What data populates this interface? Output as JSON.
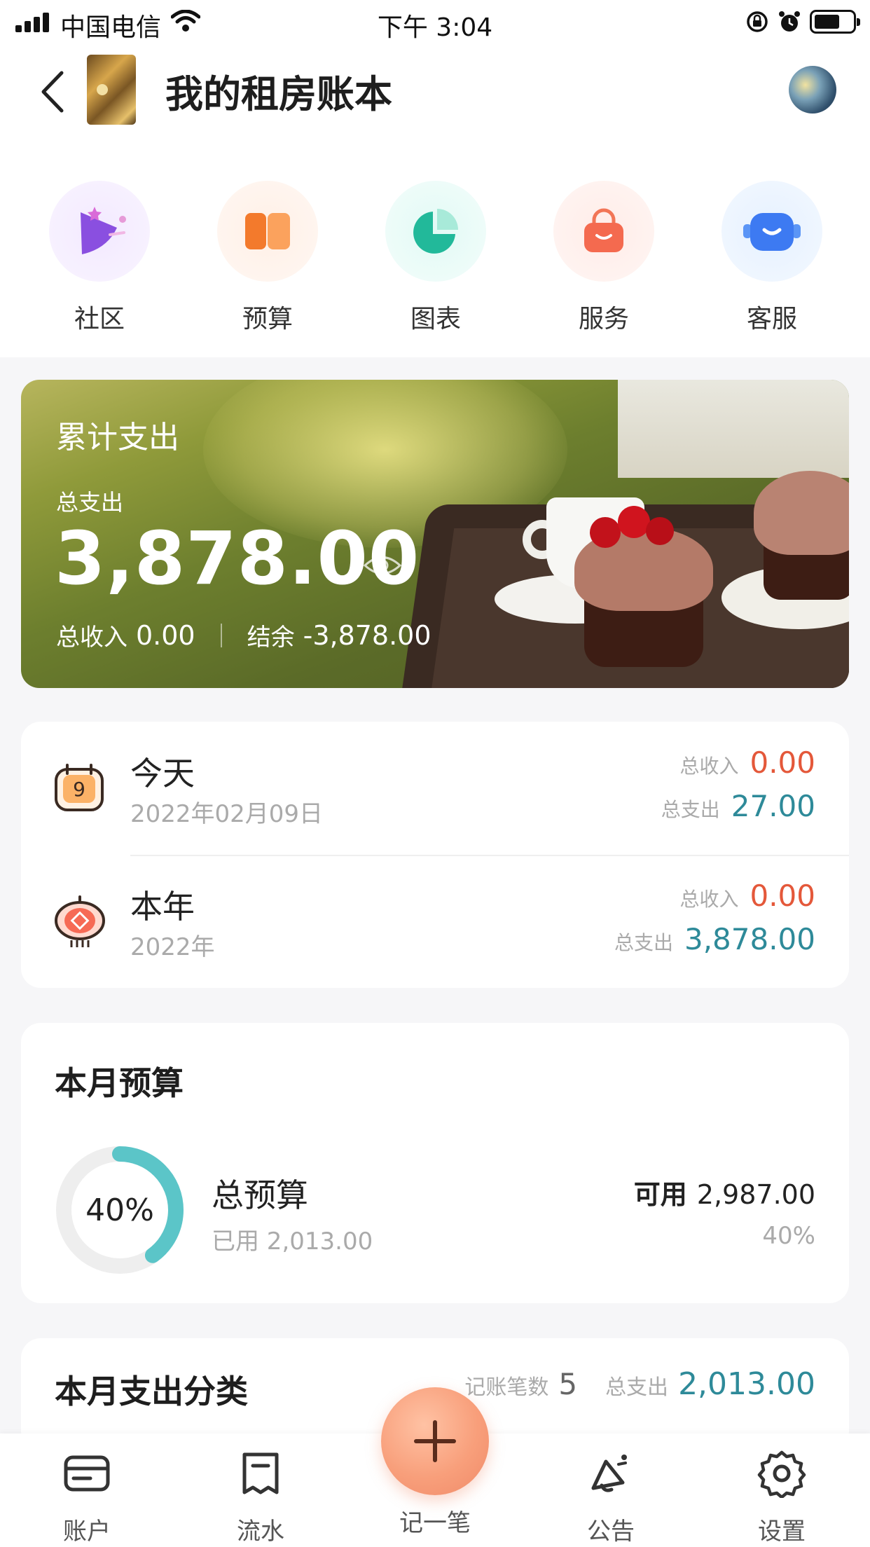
{
  "status_bar": {
    "carrier": "中国电信",
    "time": "下午 3:04"
  },
  "header": {
    "title": "我的租房账本"
  },
  "quick_menu": [
    {
      "label": "社区",
      "icon": "community-icon"
    },
    {
      "label": "预算",
      "icon": "budget-icon"
    },
    {
      "label": "图表",
      "icon": "chart-icon"
    },
    {
      "label": "服务",
      "icon": "service-bag-icon"
    },
    {
      "label": "客服",
      "icon": "customer-service-icon"
    }
  ],
  "hero": {
    "title": "累计支出",
    "total_expense_label": "总支出",
    "total_expense": "3,878.00",
    "total_income_label": "总收入",
    "total_income": "0.00",
    "balance_label": "结余",
    "balance": "-3,878.00"
  },
  "summary": {
    "rows": [
      {
        "title": "今天",
        "date": "2022年02月09日",
        "income_label": "总收入",
        "income": "0.00",
        "expense_label": "总支出",
        "expense": "27.00",
        "badge": "9"
      },
      {
        "title": "本年",
        "date": "2022年",
        "income_label": "总收入",
        "income": "0.00",
        "expense_label": "总支出",
        "expense": "3,878.00"
      }
    ]
  },
  "budget": {
    "title": "本月预算",
    "percent_text": "40%",
    "progress": 0.4,
    "name": "总预算",
    "used": "已用 2,013.00",
    "available_label": "可用",
    "available": "2,987.00",
    "percent_right": "40%"
  },
  "category": {
    "title": "本月支出分类",
    "count_label": "记账笔数",
    "count": "5",
    "expense_label": "总支出",
    "expense": "2,013.00"
  },
  "tab_bar": {
    "tabs": [
      {
        "label": "账户",
        "icon": "account-card-icon"
      },
      {
        "label": "流水",
        "icon": "journal-icon"
      },
      {
        "label": "记一笔",
        "icon": "plus-icon"
      },
      {
        "label": "公告",
        "icon": "announcement-icon"
      },
      {
        "label": "设置",
        "icon": "gear-icon"
      }
    ]
  },
  "colors": {
    "accent_orange": "#f08a68",
    "income_red": "#e4583a",
    "expense_teal": "#2e8a99",
    "budget_ring": "#5bc5c8"
  }
}
